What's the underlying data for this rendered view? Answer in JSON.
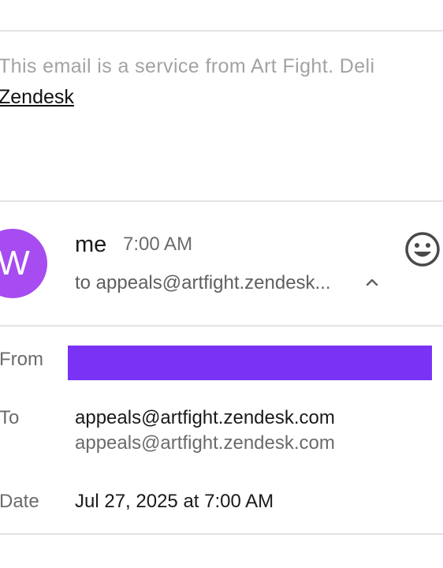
{
  "previous_message": {
    "footer_text": "This email is a service from Art Fight. Deli",
    "link_text": "Zendesk"
  },
  "message": {
    "avatar_letter": "W",
    "avatar_color": "#a64cf0",
    "sender": "me",
    "time": "7:00 AM",
    "recipient_summary": "to appeals@artfight.zendesk...",
    "emoji_icon": "smiley-face-icon",
    "expand_icon": "chevron-up-icon"
  },
  "details": {
    "from_label": "From",
    "from_redaction_color": "#7a33f5",
    "to_label": "To",
    "to_primary": "appeals@artfight.zendesk.com",
    "to_secondary": "appeals@artfight.zendesk.com",
    "date_label": "Date",
    "date_value": "Jul 27, 2025 at 7:00 AM"
  }
}
